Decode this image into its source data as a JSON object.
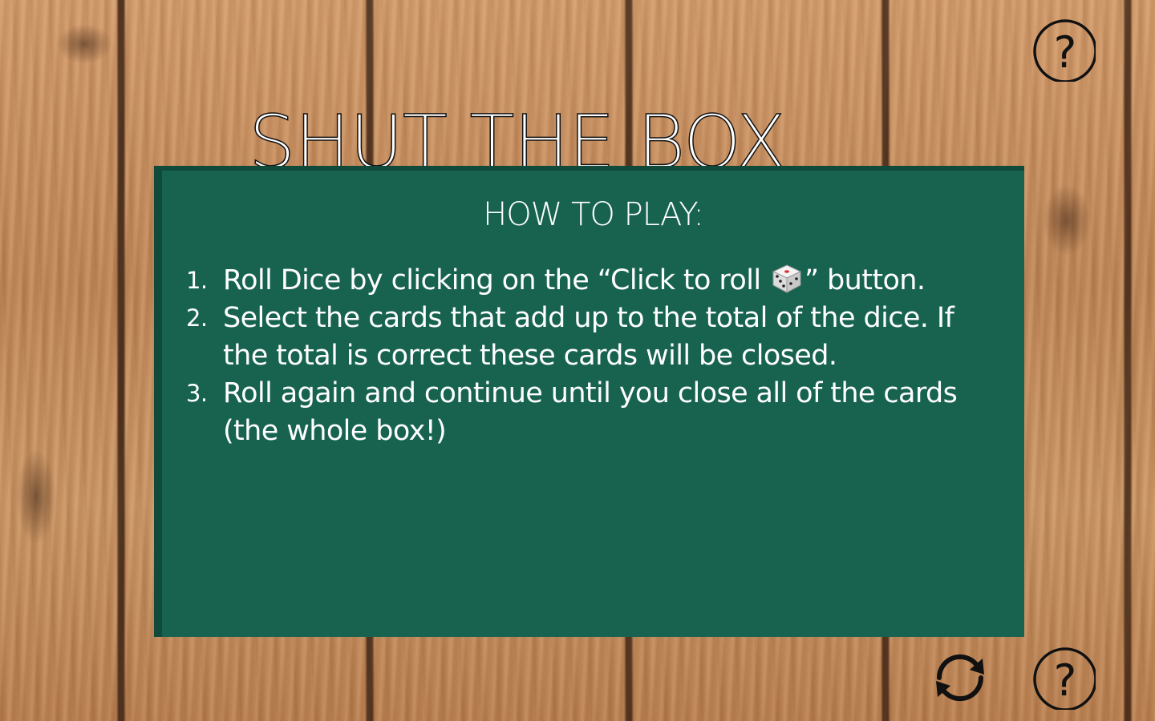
{
  "game": {
    "title": "SHUT THE BOX"
  },
  "instructions": {
    "heading": "HOW TO PLAY:",
    "steps": [
      {
        "number": "1.",
        "text_before_icon": "Roll Dice by clicking on the “Click to roll ",
        "icon": "dice-icon",
        "text_after_icon": "” button."
      },
      {
        "number": "2.",
        "text": "Select the cards that add up to the total of the dice. If the total is correct these cards will be closed."
      },
      {
        "number": "3.",
        "text": "Roll again and continue until you close all of the cards (the whole box!)"
      }
    ]
  },
  "buttons": {
    "help_top": {
      "icon": "question-mark-icon",
      "label": "?"
    },
    "restart": {
      "icon": "refresh-icon"
    },
    "help_bottom": {
      "icon": "question-mark-icon",
      "label": "?"
    }
  },
  "colors": {
    "panel": "#17634f",
    "panel_shadow": "#0f4a3a",
    "text": "#ffffff",
    "wood": "#c48a5b"
  }
}
